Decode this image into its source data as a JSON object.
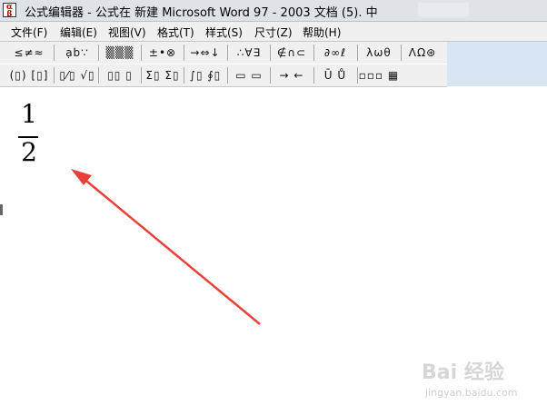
{
  "window": {
    "title": "公式编辑器 - 公式在 新建 Microsoft Word 97 - 2003 文档 (5). 中",
    "icon": "equation-editor-app-icon"
  },
  "menu": [
    {
      "label": "文件(F)"
    },
    {
      "label": "编辑(E)"
    },
    {
      "label": "视图(V)"
    },
    {
      "label": "格式(T)"
    },
    {
      "label": "样式(S)"
    },
    {
      "label": "尺寸(Z)"
    },
    {
      "label": "帮助(H)"
    }
  ],
  "toolbar_symbols": [
    {
      "label": "≤≠≈",
      "icon": "relational-symbols-icon"
    },
    {
      "label": "ạb∵",
      "icon": "spaces-ellipses-icon"
    },
    {
      "label": "▒▒▒",
      "icon": "embellishments-icon"
    },
    {
      "label": "±•⊗",
      "icon": "operator-symbols-icon"
    },
    {
      "label": "→⇔↓",
      "icon": "arrow-symbols-icon"
    },
    {
      "label": "∴∀∃",
      "icon": "logical-symbols-icon"
    },
    {
      "label": "∉∩⊂",
      "icon": "set-theory-symbols-icon"
    },
    {
      "label": "∂∞ℓ",
      "icon": "misc-symbols-icon"
    },
    {
      "label": "λωθ",
      "icon": "greek-lowercase-icon"
    },
    {
      "label": "ΛΩ⊛",
      "icon": "greek-uppercase-icon"
    }
  ],
  "toolbar_templates": [
    {
      "label": "(▯) [▯]",
      "icon": "fence-templates-icon"
    },
    {
      "label": "▯⁄▯ √▯",
      "icon": "fraction-radical-templates-icon"
    },
    {
      "label": "▯▯ ▯",
      "icon": "subscript-superscript-templates-icon"
    },
    {
      "label": "Σ▯ Σ▯",
      "icon": "summation-templates-icon"
    },
    {
      "label": "∫▯ ∮▯",
      "icon": "integral-templates-icon"
    },
    {
      "label": "▭ ▭",
      "icon": "underbar-overbar-templates-icon"
    },
    {
      "label": "→ ←",
      "icon": "labeled-arrow-templates-icon"
    },
    {
      "label": "Ū Ů",
      "icon": "products-set-theory-templates-icon"
    },
    {
      "label": "▫▫▫ ▦",
      "icon": "matrix-templates-icon"
    }
  ],
  "equation": {
    "numerator": "1",
    "denominator": "2"
  },
  "annotation": {
    "color": "#e8413a"
  },
  "watermark": {
    "text": "Bai 经验",
    "url": "jingyan.baidu.com"
  }
}
